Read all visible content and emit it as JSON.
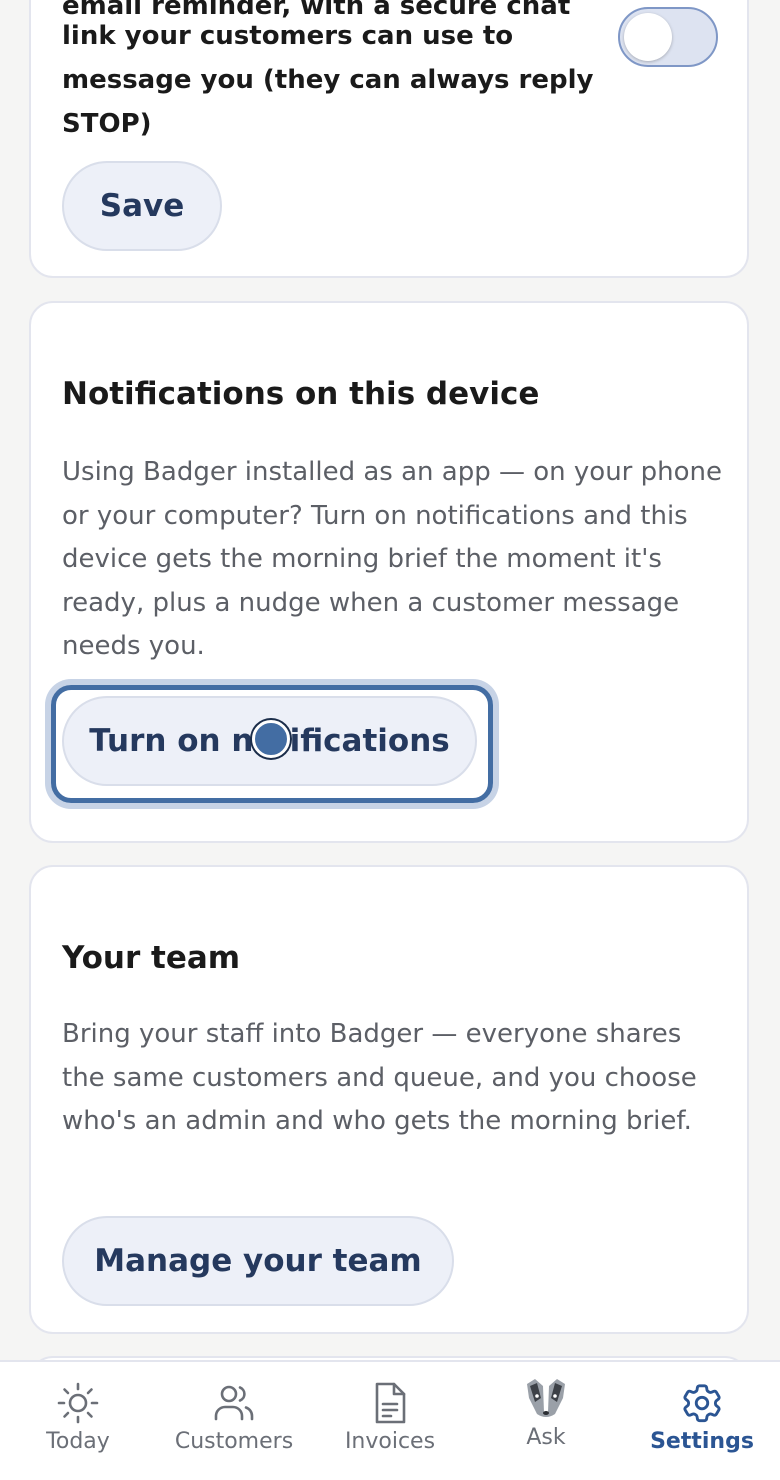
{
  "reminders_card": {
    "text_lines": [
      "email reminder, with a secure chat",
      "link your customers can use to",
      "message you (they can always reply",
      "STOP)"
    ],
    "toggle_state": "off",
    "save_label": "Save"
  },
  "notifications_card": {
    "title": "Notifications on this device",
    "body": "Using Badger installed as an app — on your phone or your computer? Turn on notifications and this device gets the morning brief the moment it's ready, plus a nudge when a customer message needs you.",
    "button_label": "Turn on notifications"
  },
  "team_card": {
    "title": "Your team",
    "body": "Bring your staff into Badger — everyone shares the same customers and queue, and you choose who's an admin and who gets the morning brief.",
    "button_label": "Manage your team"
  },
  "tabbar": {
    "active": "Settings",
    "accent_color": "#2b5593",
    "items": [
      {
        "label": "Today",
        "icon": "sun-icon"
      },
      {
        "label": "Customers",
        "icon": "users-icon"
      },
      {
        "label": "Invoices",
        "icon": "document-icon"
      },
      {
        "label": "Ask",
        "icon": "badger-icon"
      },
      {
        "label": "Settings",
        "icon": "gear-icon"
      }
    ]
  }
}
